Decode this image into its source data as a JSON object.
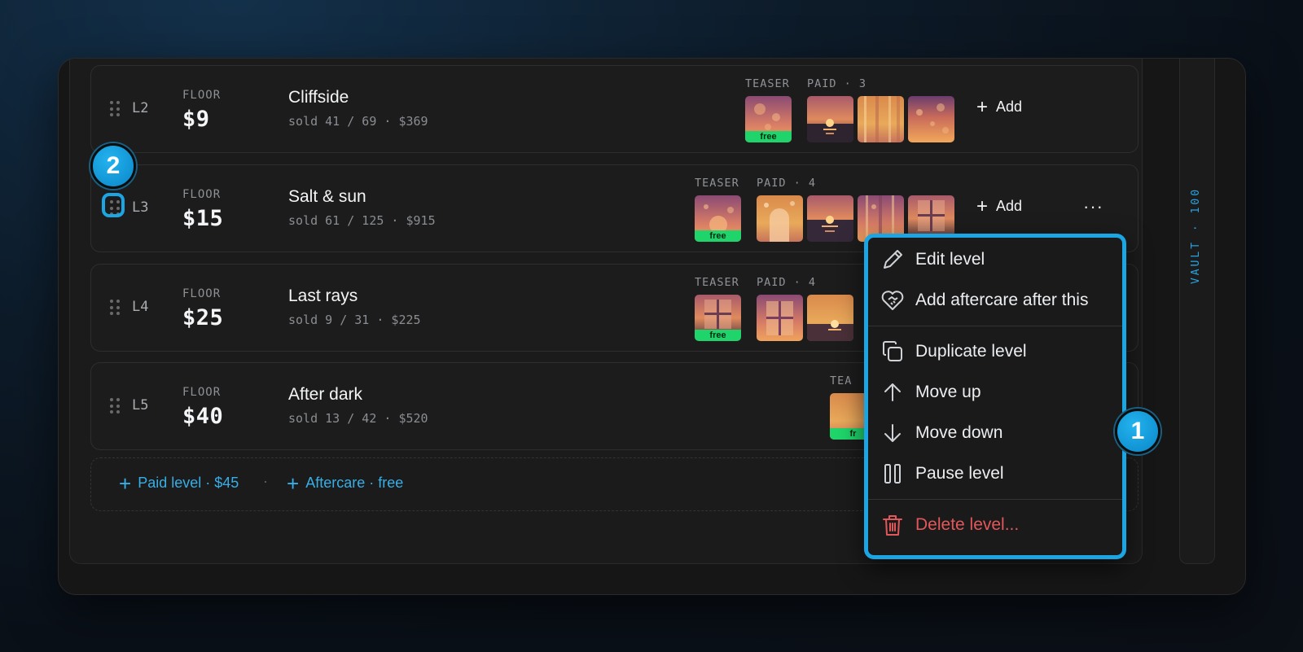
{
  "rail": {
    "label": "VAULT · 100"
  },
  "levels": [
    {
      "id": "L2",
      "floor_label": "FLOOR",
      "price": "$9",
      "name": "Cliffside",
      "sold": "sold 41 / 69 · $369",
      "teaser_label": "TEASER",
      "paid_label": "PAID · 3",
      "add_label": "Add"
    },
    {
      "id": "L3",
      "floor_label": "FLOOR",
      "price": "$15",
      "name": "Salt & sun",
      "sold": "sold 61 / 125 · $915",
      "teaser_label": "TEASER",
      "paid_label": "PAID · 4",
      "add_label": "Add",
      "more_label": "···"
    },
    {
      "id": "L4",
      "floor_label": "FLOOR",
      "price": "$25",
      "name": "Last rays",
      "sold": "sold 9 / 31 · $225",
      "teaser_label": "TEASER",
      "paid_label": "PAID · 4"
    },
    {
      "id": "L5",
      "floor_label": "FLOOR",
      "price": "$40",
      "name": "After dark",
      "sold": "sold 13 / 42 · $520",
      "teaser_label": "TEA"
    }
  ],
  "free_label": "free",
  "free_label_partial": "fr",
  "addbar": {
    "paid_level": "Paid level · $45",
    "separator": "·",
    "aftercare": "Aftercare · free"
  },
  "menu": {
    "items": [
      {
        "label": "Edit level",
        "icon": "pencil-icon"
      },
      {
        "label": "Add aftercare after this",
        "icon": "heart-handshake-icon"
      },
      {
        "label": "Duplicate level",
        "icon": "copy-icon"
      },
      {
        "label": "Move up",
        "icon": "arrow-up-icon"
      },
      {
        "label": "Move down",
        "icon": "arrow-down-icon"
      },
      {
        "label": "Pause level",
        "icon": "pause-icon"
      },
      {
        "label": "Delete level...",
        "icon": "trash-icon",
        "color": "#e2575a"
      }
    ]
  },
  "callouts": {
    "menu": "1",
    "drag_handle": "2"
  },
  "colors": {
    "accent": "#1ca5e3",
    "free_badge": "#1fd46a",
    "danger": "#e2575a"
  }
}
